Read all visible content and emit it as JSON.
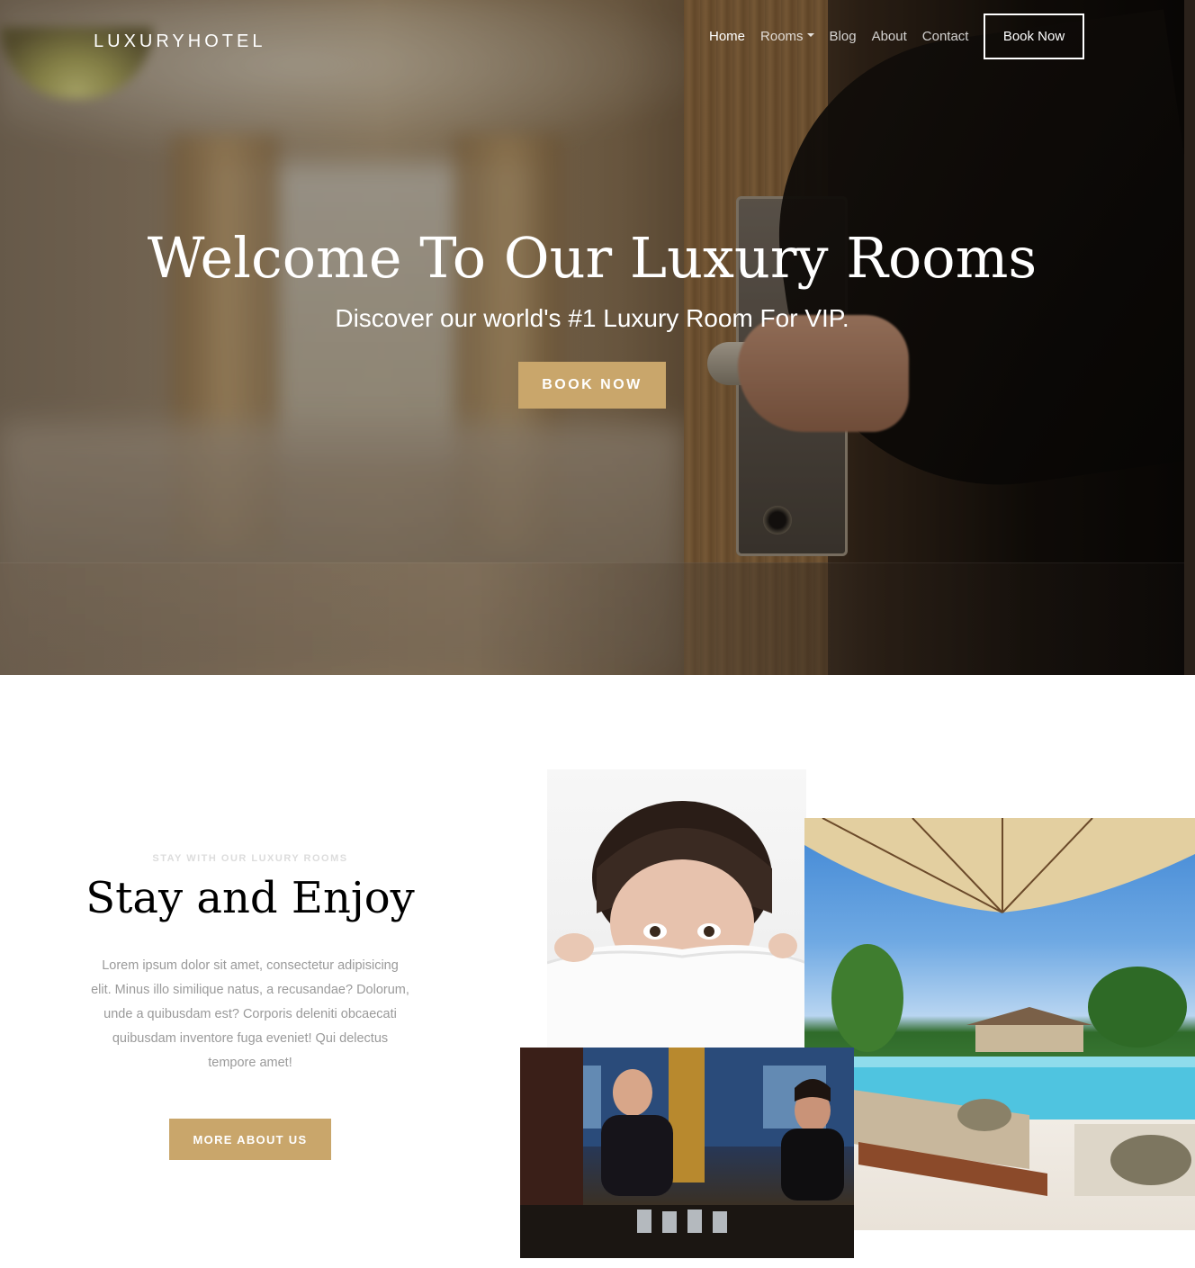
{
  "nav": {
    "brand": "LUXURYHOTEL",
    "links": [
      {
        "label": "Home",
        "active": true
      },
      {
        "label": "Rooms",
        "dropdown": true
      },
      {
        "label": "Blog"
      },
      {
        "label": "About"
      },
      {
        "label": "Contact"
      }
    ],
    "book_label": "Book Now"
  },
  "hero": {
    "title": "Welcome To Our Luxury Rooms",
    "subtitle": "Discover our world's #1 Luxury Room For VIP.",
    "button_label": "BOOK NOW"
  },
  "about": {
    "eyebrow": "STAY WITH OUR LUXURY ROOMS",
    "title": "Stay and Enjoy",
    "text": "Lorem ipsum dolor sit amet, consectetur adipisicing elit. Minus illo similique natus, a recusandae? Dolorum, unde a quibusdam est? Corporis deleniti obcaecati quibusdam inventore fuga eveniet! Qui delectus tempore amet!",
    "button_label": "MORE ABOUT US"
  },
  "colors": {
    "accent": "#c9a66b",
    "heading": "#000000",
    "muted_text": "#9a9a9a"
  },
  "icons": {
    "rooms_dropdown": "caret-down-icon"
  }
}
